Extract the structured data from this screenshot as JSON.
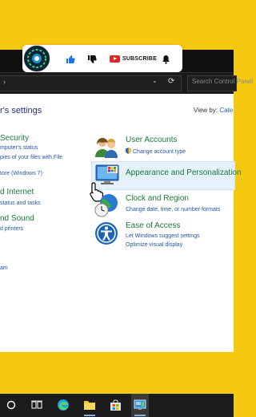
{
  "overlay": {
    "subscribe_label": "SUBSCRIBE"
  },
  "address_bar": {
    "search_placeholder": "Search Control Panel"
  },
  "control_panel": {
    "heading": "r's settings",
    "view_by_label": "View by:",
    "view_by_value": "Cate",
    "left_items": [
      {
        "title": "Security",
        "subs": [
          "mputer's status",
          "pies of your files with File",
          "tore (Windows 7)"
        ]
      },
      {
        "title": "d Internet",
        "subs": [
          "status and tasks"
        ]
      },
      {
        "title": "nd Sound",
        "subs": [
          "d printers"
        ]
      },
      {
        "title": "",
        "subs": [
          "am"
        ]
      }
    ],
    "right_items": [
      {
        "title": "User Accounts",
        "subs": [
          "Change account type"
        ],
        "icon": "users-icon"
      },
      {
        "title": "Appearance and Personalization",
        "subs": [],
        "icon": "appearance-icon"
      },
      {
        "title": "Clock and Region",
        "subs": [
          "Change date, time, or number formats"
        ],
        "icon": "clock-globe-icon"
      },
      {
        "title": "Ease of Access",
        "subs": [
          "Let Windows suggest settings",
          "Optimize visual display"
        ],
        "icon": "ease-of-access-icon"
      }
    ]
  },
  "colors": {
    "background": "#f5c911",
    "category_title": "#1a7a39",
    "link": "#1f56a8"
  }
}
